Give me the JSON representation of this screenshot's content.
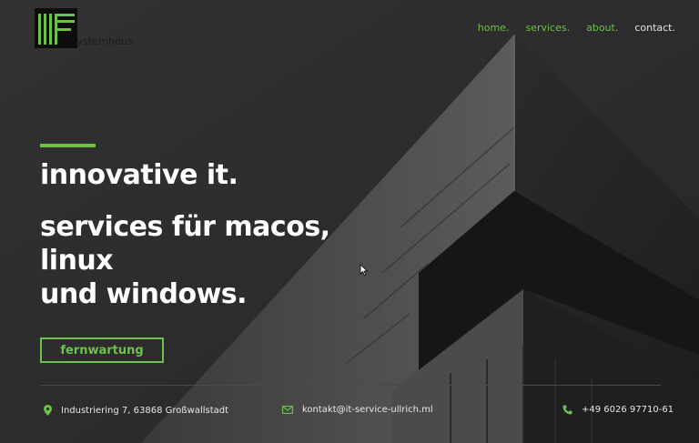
{
  "brand": {
    "logo_text": "ystemhous"
  },
  "nav": {
    "items": [
      "home.",
      "services.",
      "about.",
      "contact."
    ]
  },
  "hero": {
    "title": "innovative it.",
    "subtitle_lines": [
      "services für macos,",
      "linux",
      "und windows."
    ],
    "cta_label": "fernwartung"
  },
  "contact": {
    "address": "Industriering 7, 63868 Großwallstadt",
    "email": "kontakt@it-service-ullrich.ml",
    "phone": "+49 6026 97710-61"
  },
  "colors": {
    "accent": "#6cc24a",
    "background": "#2b2b2b"
  },
  "icons": [
    "map-pin-icon",
    "mail-icon",
    "phone-icon",
    "mouse-cursor-icon"
  ]
}
